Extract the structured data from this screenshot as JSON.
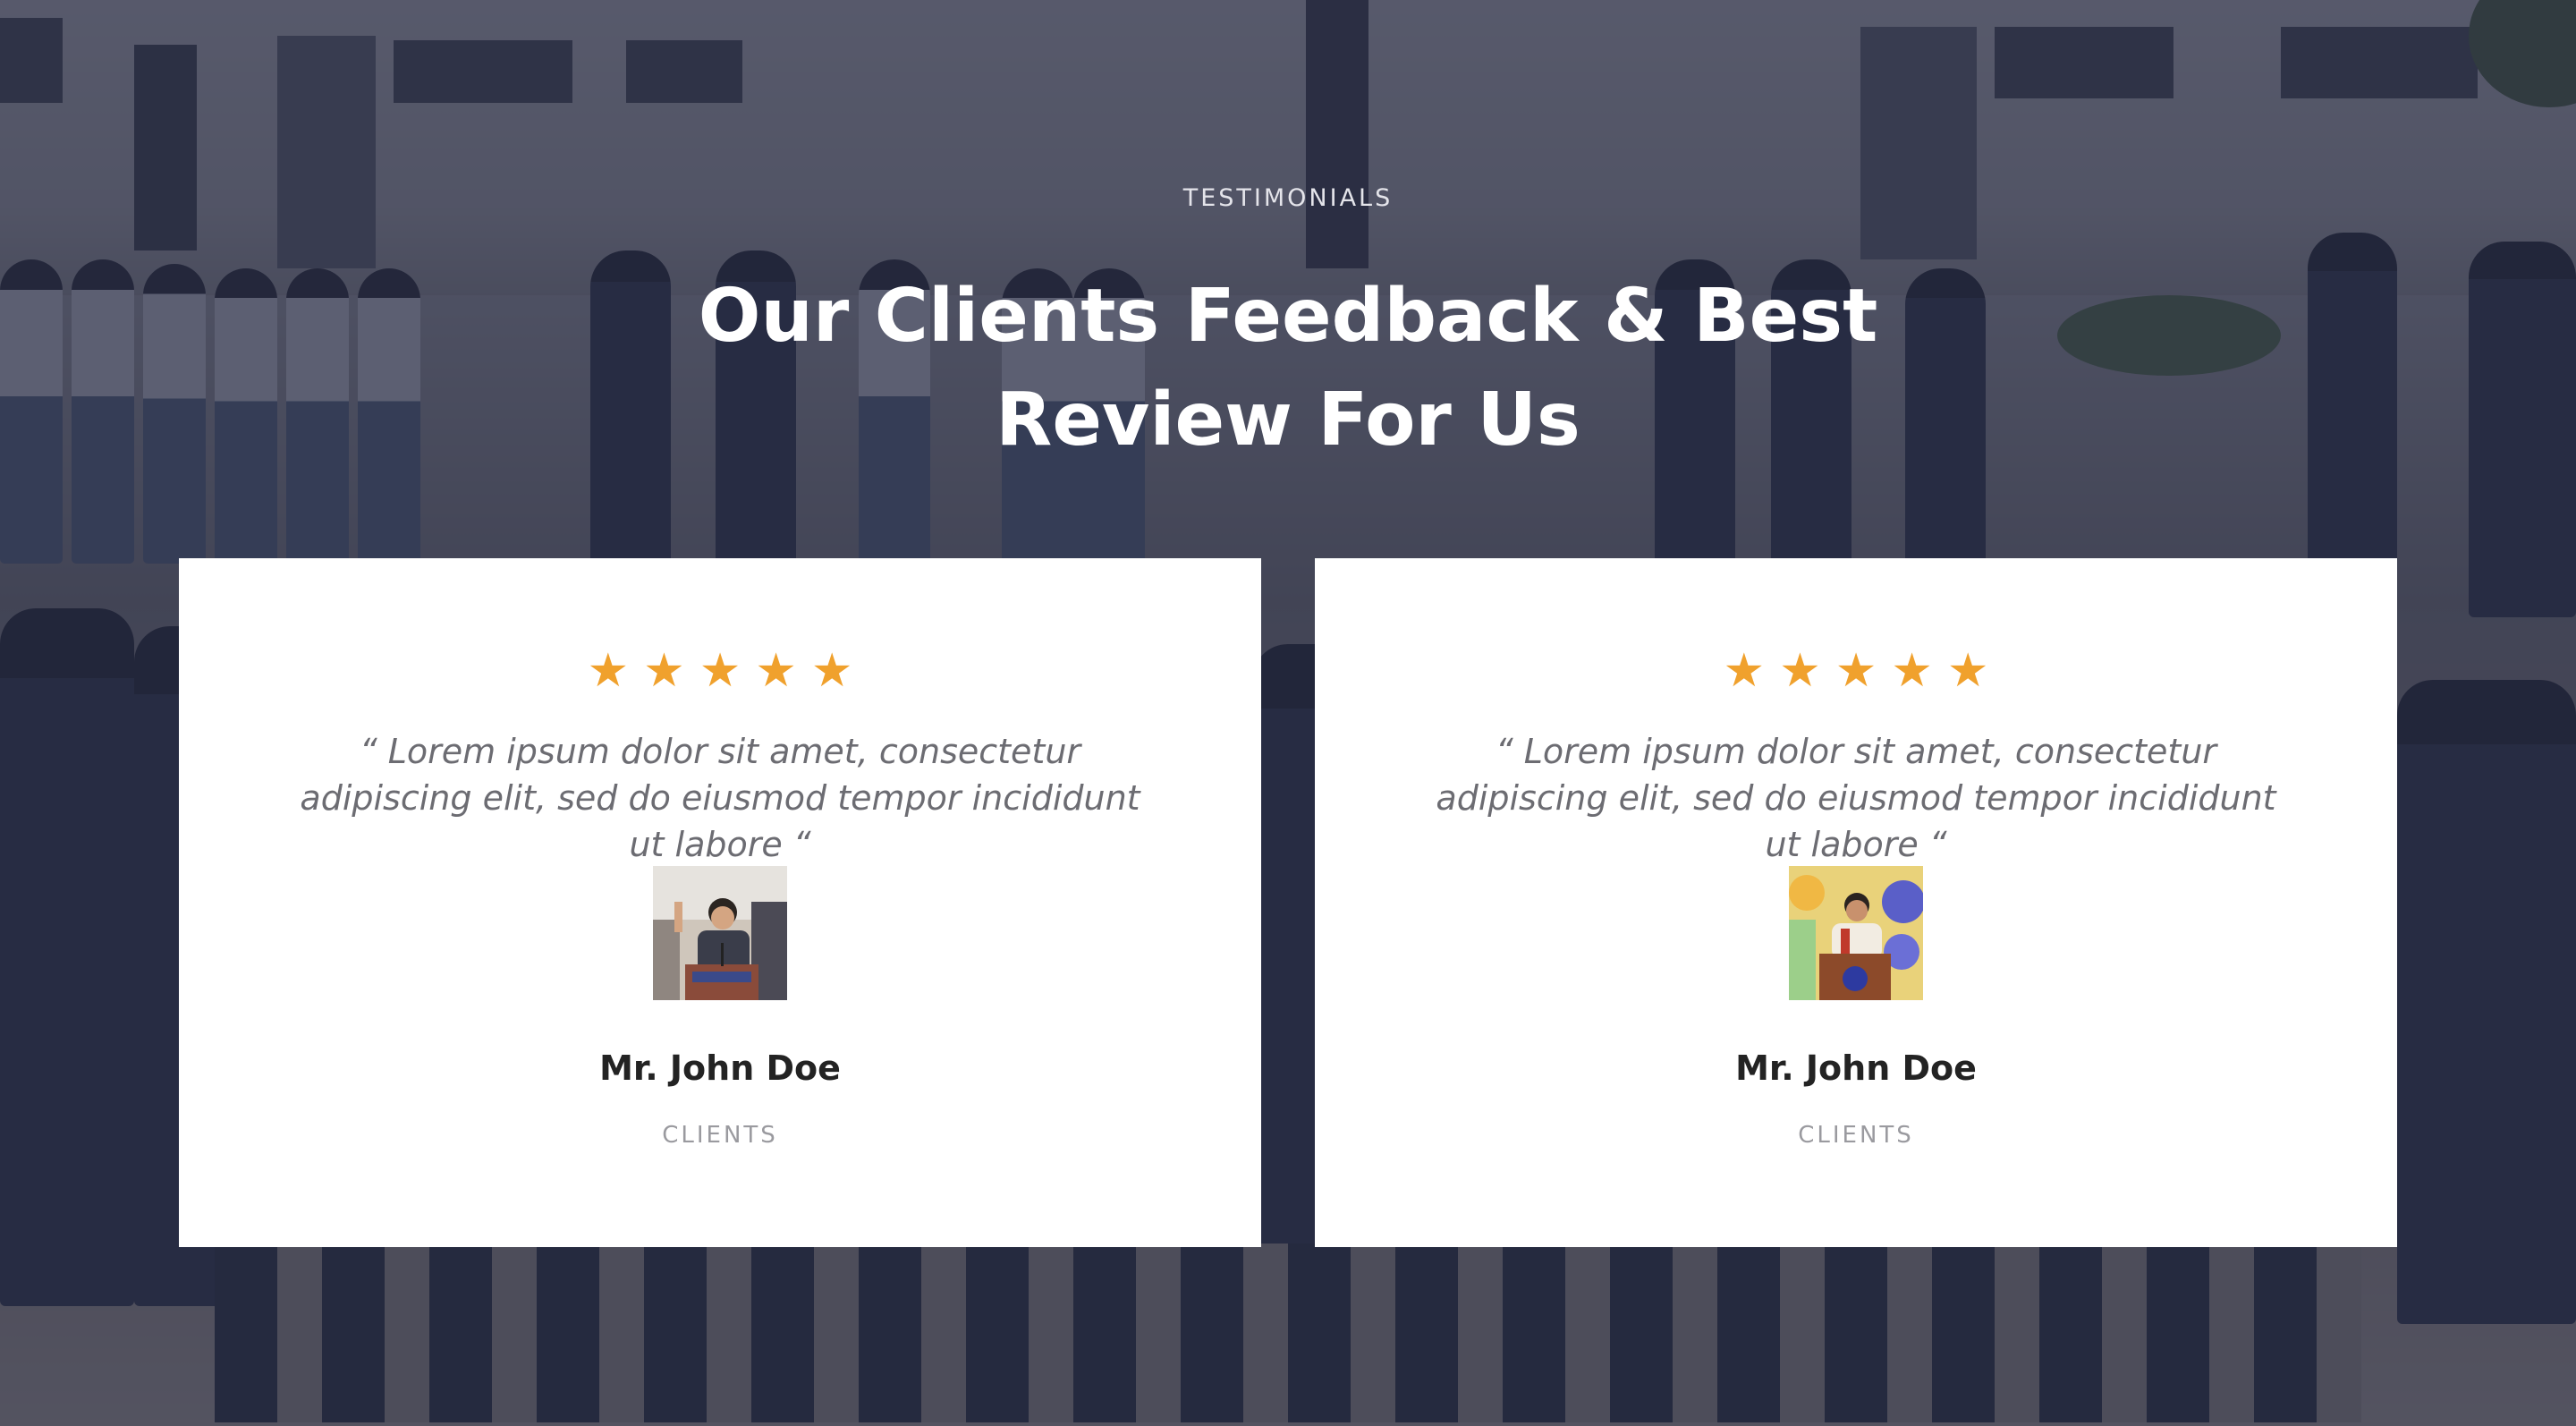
{
  "section": {
    "eyebrow": "TESTIMONIALS",
    "title_line1": "Our Clients Feedback & Best",
    "title_line2": "Review For Us"
  },
  "colors": {
    "overlay": "#262942",
    "star": "#f0a12d",
    "card_bg": "#ffffff",
    "quote_text": "#6c6c72",
    "name_text": "#232323",
    "role_text": "#9a9a9f"
  },
  "testimonials": [
    {
      "rating": 5,
      "stars": "★★★★★",
      "quote": "“ Lorem ipsum dolor sit amet, consectetur adipiscing elit, sed do eiusmod tempor incididunt ut labore “",
      "avatar_icon": "speaker-at-podium-photo",
      "name": "Mr. John Doe",
      "role": "CLIENTS"
    },
    {
      "rating": 5,
      "stars": "★★★★★",
      "quote": "“ Lorem ipsum dolor sit amet, consectetur adipiscing elit, sed do eiusmod tempor incididunt ut labore “",
      "avatar_icon": "speaker-at-podium-photo",
      "name": "Mr. John Doe",
      "role": "CLIENTS"
    }
  ]
}
